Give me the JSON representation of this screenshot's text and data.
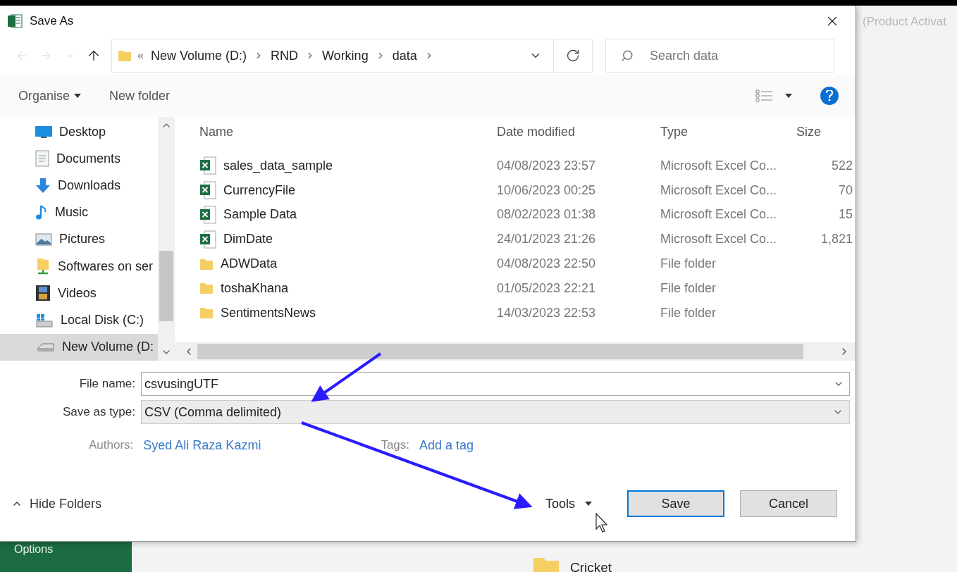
{
  "window": {
    "title": "Save As"
  },
  "background": {
    "title_fragment": "(Product Activat",
    "sidebar_item": "Options",
    "folder": "Cricket"
  },
  "address": {
    "overflow": "«",
    "path": [
      "New Volume (D:)",
      "RND",
      "Working",
      "data"
    ]
  },
  "search": {
    "placeholder": "Search data"
  },
  "toolbar": {
    "organise": "Organise",
    "new_folder": "New folder"
  },
  "sidebar": {
    "items": [
      {
        "label": "Desktop",
        "selected": false
      },
      {
        "label": "Documents",
        "selected": false
      },
      {
        "label": "Downloads",
        "selected": false
      },
      {
        "label": "Music",
        "selected": false
      },
      {
        "label": "Pictures",
        "selected": false
      },
      {
        "label": "Softwares on ser",
        "selected": false
      },
      {
        "label": "Videos",
        "selected": false
      },
      {
        "label": "Local Disk (C:)",
        "selected": false
      },
      {
        "label": "New Volume (D:",
        "selected": true
      }
    ]
  },
  "table": {
    "columns": [
      "Name",
      "Date modified",
      "Type",
      "Size"
    ],
    "rows": [
      {
        "kind": "excel",
        "name": "sales_data_sample",
        "date": "04/08/2023 23:57",
        "type": "Microsoft Excel Co...",
        "size": "522"
      },
      {
        "kind": "excel",
        "name": "CurrencyFile",
        "date": "10/06/2023 00:25",
        "type": "Microsoft Excel Co...",
        "size": "70"
      },
      {
        "kind": "excel",
        "name": "Sample Data",
        "date": "08/02/2023 01:38",
        "type": "Microsoft Excel Co...",
        "size": "15"
      },
      {
        "kind": "excel",
        "name": "DimDate",
        "date": "24/01/2023 21:26",
        "type": "Microsoft Excel Co...",
        "size": "1,821"
      },
      {
        "kind": "folder",
        "name": "ADWData",
        "date": "04/08/2023 22:50",
        "type": "File folder"
      },
      {
        "kind": "folder",
        "name": "toshaKhana",
        "date": "01/05/2023 22:21",
        "type": "File folder"
      },
      {
        "kind": "folder",
        "name": "SentimentsNews",
        "date": "14/03/2023 22:53",
        "type": "File folder"
      }
    ]
  },
  "form": {
    "file_name_label": "File name:",
    "file_name": "csvusingUTF",
    "type_label": "Save as type:",
    "type": "CSV (Comma delimited)",
    "authors_label": "Authors:",
    "author": "Syed Ali Raza Kazmi",
    "tags_label": "Tags:",
    "tags_link": "Add a tag"
  },
  "footer": {
    "hide_folders": "Hide Folders",
    "tools": "Tools",
    "buttons": [
      {
        "label": "Save",
        "default": true
      },
      {
        "label": "Cancel",
        "default": false
      }
    ]
  }
}
